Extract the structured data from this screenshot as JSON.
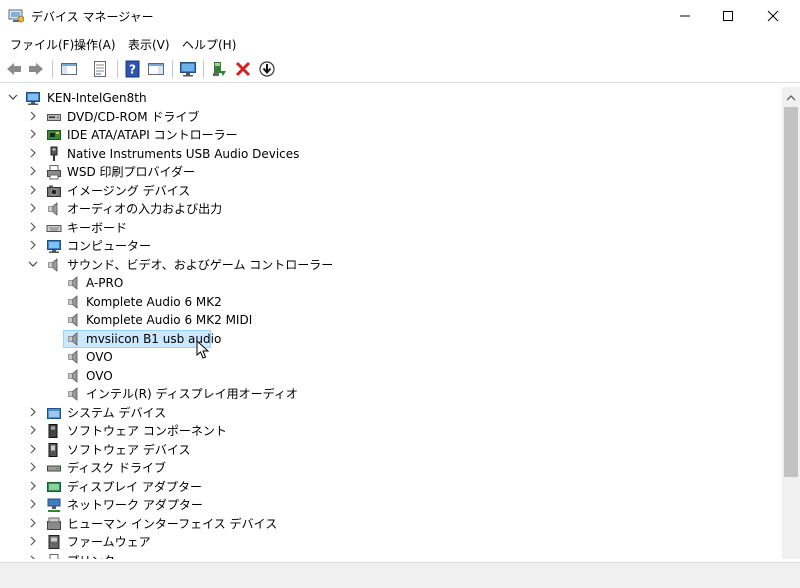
{
  "window": {
    "title": "デバイス マネージャー",
    "minimize_glyph": "—",
    "maximize_glyph": "☐",
    "close_glyph": "✕"
  },
  "menu": [
    "ファイル(F)",
    "操作(A)",
    "表示(V)",
    "ヘルプ(H)"
  ],
  "toolbar": [
    {
      "name": "back-button",
      "icon": "arrow-left-icon"
    },
    {
      "name": "forward-button",
      "icon": "arrow-right-icon"
    },
    {
      "name": "show-hide-console-tree-button",
      "icon": "console-tree-icon"
    },
    {
      "name": "properties-button",
      "icon": "properties-icon"
    },
    {
      "name": "help-button",
      "icon": "help-icon"
    },
    {
      "name": "action-pane-button",
      "icon": "action-pane-icon"
    },
    {
      "name": "scan-hardware-button",
      "icon": "monitor-scan-icon"
    },
    {
      "name": "update-driver-button",
      "icon": "update-driver-icon"
    },
    {
      "name": "uninstall-device-button",
      "icon": "red-x-icon"
    },
    {
      "name": "disable-device-button",
      "icon": "down-arrow-circle-icon"
    }
  ],
  "tree": {
    "root": {
      "label": "KEN-IntelGen8th",
      "icon": "computer-icon",
      "expanded": true
    },
    "items": [
      {
        "label": "DVD/CD-ROM ドライブ",
        "icon": "dvd-drive-icon",
        "level": 1,
        "expander": "collapsed"
      },
      {
        "label": "IDE ATA/ATAPI コントローラー",
        "icon": "ide-controller-icon",
        "level": 1,
        "expander": "collapsed"
      },
      {
        "label": "Native Instruments USB Audio Devices",
        "icon": "usb-audio-device-icon",
        "level": 1,
        "expander": "collapsed"
      },
      {
        "label": "WSD 印刷プロバイダー",
        "icon": "printer-icon",
        "level": 1,
        "expander": "collapsed"
      },
      {
        "label": "イメージング デバイス",
        "icon": "camera-icon",
        "level": 1,
        "expander": "collapsed"
      },
      {
        "label": "オーディオの入力および出力",
        "icon": "speaker-icon",
        "level": 1,
        "expander": "collapsed"
      },
      {
        "label": "キーボード",
        "icon": "keyboard-icon",
        "level": 1,
        "expander": "collapsed"
      },
      {
        "label": "コンピューター",
        "icon": "monitor-icon",
        "level": 1,
        "expander": "collapsed"
      },
      {
        "label": "サウンド、ビデオ、およびゲーム コントローラー",
        "icon": "speaker-icon",
        "level": 1,
        "expander": "expanded"
      },
      {
        "label": "A-PRO",
        "icon": "speaker-icon",
        "level": 2,
        "expander": "none"
      },
      {
        "label": "Komplete Audio 6 MK2",
        "icon": "speaker-icon",
        "level": 2,
        "expander": "none"
      },
      {
        "label": "Komplete Audio 6 MK2 MIDI",
        "icon": "speaker-icon",
        "level": 2,
        "expander": "none"
      },
      {
        "label": "mvsiicon B1 usb audio",
        "icon": "speaker-icon",
        "level": 2,
        "expander": "none",
        "selected": true
      },
      {
        "label": "OVO",
        "icon": "speaker-icon",
        "level": 2,
        "expander": "none"
      },
      {
        "label": "OVO",
        "icon": "speaker-icon",
        "level": 2,
        "expander": "none"
      },
      {
        "label": "インテル(R) ディスプレイ用オーディオ",
        "icon": "speaker-icon",
        "level": 2,
        "expander": "none"
      },
      {
        "label": "システム デバイス",
        "icon": "system-folder-icon",
        "level": 1,
        "expander": "collapsed"
      },
      {
        "label": "ソフトウェア コンポーネント",
        "icon": "software-component-icon",
        "level": 1,
        "expander": "collapsed"
      },
      {
        "label": "ソフトウェア デバイス",
        "icon": "software-device-icon",
        "level": 1,
        "expander": "collapsed"
      },
      {
        "label": "ディスク ドライブ",
        "icon": "disk-drive-icon",
        "level": 1,
        "expander": "collapsed"
      },
      {
        "label": "ディスプレイ アダプター",
        "icon": "display-adapter-icon",
        "level": 1,
        "expander": "collapsed"
      },
      {
        "label": "ネットワーク アダプター",
        "icon": "network-adapter-icon",
        "level": 1,
        "expander": "collapsed"
      },
      {
        "label": "ヒューマン インターフェイス デバイス",
        "icon": "hid-icon",
        "level": 1,
        "expander": "collapsed"
      },
      {
        "label": "ファームウェア",
        "icon": "firmware-icon",
        "level": 1,
        "expander": "collapsed"
      },
      {
        "label": "プリンター",
        "icon": "printer-icon",
        "level": 1,
        "expander": "collapsed"
      }
    ]
  },
  "colors": {
    "selection_bg": "#cce8ff",
    "selection_border": "#99d1ff",
    "chrome_bg": "#f0f0f0",
    "scroll_thumb": "#c2c2c2",
    "delete_red": "#d42020"
  }
}
